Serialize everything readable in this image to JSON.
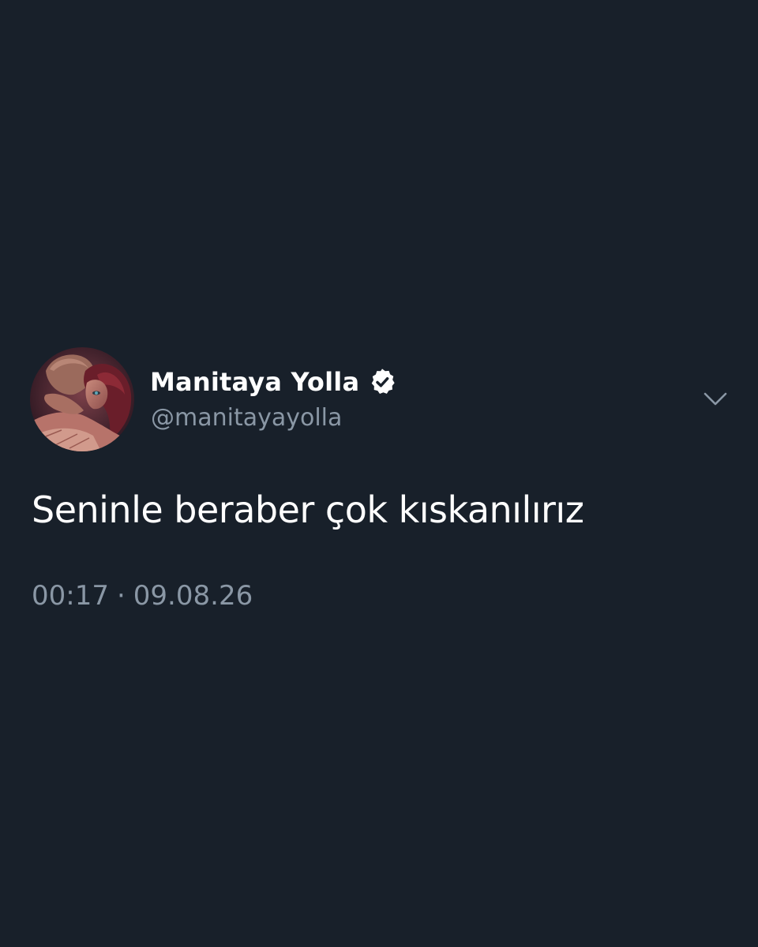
{
  "tweet": {
    "display_name": "Manitaya Yolla",
    "handle": "@manitayayolla",
    "verified": true,
    "text": "Seninle beraber çok kıskanılırız",
    "time": "00:17",
    "separator": "·",
    "date": "09.08.26"
  },
  "icons": {
    "verified": "verified-badge-icon",
    "menu": "chevron-down-icon"
  },
  "colors": {
    "background": "#18202a",
    "primary_text": "#ffffff",
    "secondary_text": "#8a97a5"
  }
}
